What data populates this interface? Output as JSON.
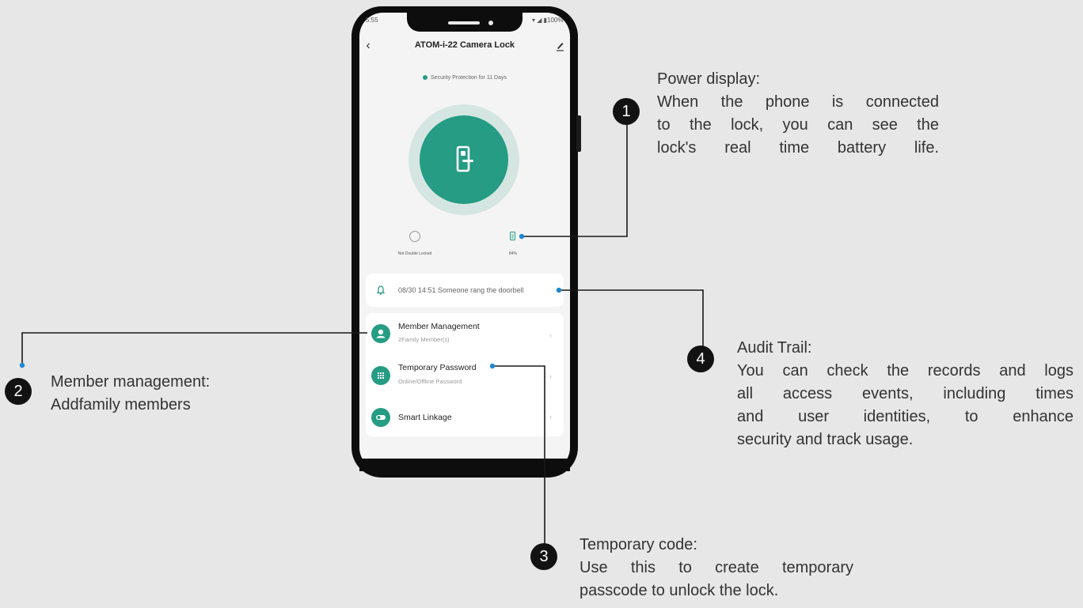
{
  "phone": {
    "status_time": "5:55",
    "status_icons": "▾ ◢ ▮100%",
    "title": "ATOM-i-22 Camera Lock",
    "security_text": "Security Protection for 11 Days",
    "double_lock_label": "Not Double Locked",
    "battery_label": "84%",
    "doorbell_event": "08/30 14:51 Someone rang the doorbell",
    "menu": [
      {
        "title": "Member Management",
        "subtitle": "2Family Member(s)",
        "icon": "person-icon"
      },
      {
        "title": "Temporary Password",
        "subtitle": "Online/Offline Password",
        "icon": "keypad-icon"
      },
      {
        "title": "Smart Linkage",
        "subtitle": "",
        "icon": "toggle-icon"
      }
    ],
    "accent_color": "#259c83"
  },
  "annotations": [
    {
      "number": "1",
      "title": "Power display:",
      "lines": [
        "When the phone is connected",
        "to the lock, you can see the",
        "lock's real time battery life."
      ]
    },
    {
      "number": "2",
      "title": "Member management:",
      "lines": [
        "Addfamily members"
      ]
    },
    {
      "number": "3",
      "title": "Temporary code:",
      "lines": [
        "Use this to create temporary",
        "passcode to unlock the lock."
      ]
    },
    {
      "number": "4",
      "title": "Audit Trail:",
      "lines": [
        "You can check the records and logs",
        "all access events, including times",
        "and user identities, to enhance",
        "security and track usage."
      ]
    }
  ]
}
